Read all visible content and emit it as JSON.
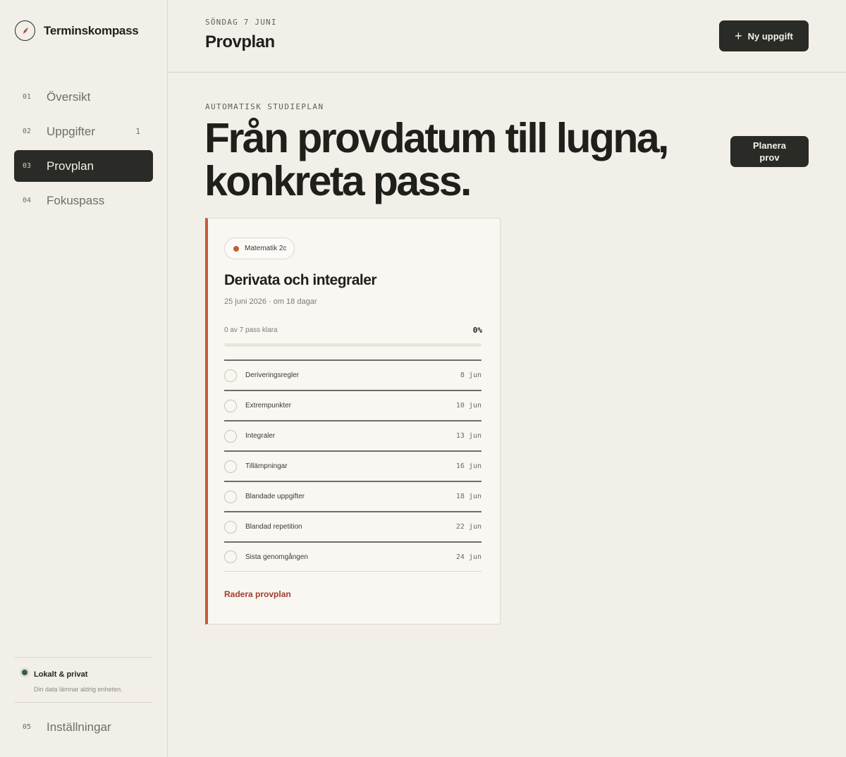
{
  "app": {
    "name": "Terminskompass"
  },
  "sidebar": {
    "nav": [
      {
        "num": "01",
        "label": "Översikt",
        "badge": ""
      },
      {
        "num": "02",
        "label": "Uppgifter",
        "badge": "1"
      },
      {
        "num": "03",
        "label": "Provplan",
        "badge": "",
        "active": true
      },
      {
        "num": "04",
        "label": "Fokuspass",
        "badge": ""
      }
    ],
    "privacy": {
      "title": "Lokalt & privat",
      "subtitle": "Din data lämnar aldrig enheten."
    },
    "settings": {
      "num": "05",
      "label": "Inställningar"
    }
  },
  "header": {
    "date": "SÖNDAG 7 JUNI",
    "title": "Provplan",
    "new_button": "Ny uppgift"
  },
  "hero": {
    "eyebrow": "AUTOMATISK STUDIEPLAN",
    "line1": "Från provdatum till lugna,",
    "line2": "konkreta pass.",
    "plan_button": "Planera prov"
  },
  "exam": {
    "subject": "Matematik 2c",
    "title": "Derivata och integraler",
    "meta": "25 juni 2026 · om 18 dagar",
    "progress_label": "0 av 7 pass klara",
    "progress_percent": "0%",
    "progress_value": 0,
    "sessions": [
      {
        "name": "Deriveringsregler",
        "date": "8 jun"
      },
      {
        "name": "Extrempunkter",
        "date": "10 jun"
      },
      {
        "name": "Integraler",
        "date": "13 jun"
      },
      {
        "name": "Tillämpningar",
        "date": "16 jun"
      },
      {
        "name": "Blandade uppgifter",
        "date": "18 jun"
      },
      {
        "name": "Blandad repetition",
        "date": "22 jun"
      },
      {
        "name": "Sista genomgången",
        "date": "24 jun"
      }
    ],
    "delete_label": "Radera provplan"
  },
  "colors": {
    "accent": "#c45c34",
    "dark": "#2a2b26",
    "background": "#f2efe9",
    "danger": "#a33a2c",
    "privacy_dot": "#3d5a48"
  }
}
